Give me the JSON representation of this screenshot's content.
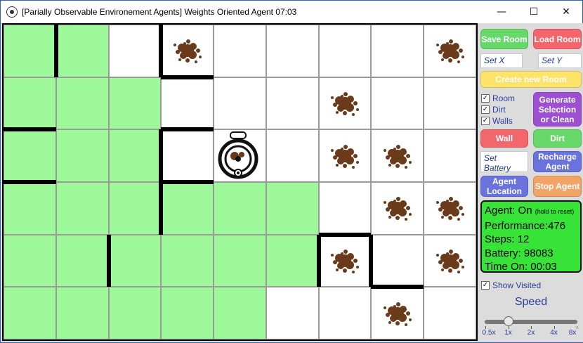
{
  "window": {
    "title": "[Parially Observable Environement Agents] Weights Oriented Agent 07:03",
    "minimize_glyph": "—",
    "maximize_glyph": "☐",
    "close_glyph": "✕"
  },
  "grid": {
    "cols": 9,
    "rows": 6,
    "visited": [
      [
        0,
        0
      ],
      [
        1,
        0
      ],
      [
        0,
        1
      ],
      [
        1,
        1
      ],
      [
        2,
        1
      ],
      [
        0,
        2
      ],
      [
        1,
        2
      ],
      [
        2,
        2
      ],
      [
        0,
        3
      ],
      [
        1,
        3
      ],
      [
        2,
        3
      ],
      [
        3,
        3
      ],
      [
        4,
        3
      ],
      [
        5,
        3
      ],
      [
        0,
        4
      ],
      [
        1,
        4
      ],
      [
        2,
        4
      ],
      [
        3,
        4
      ],
      [
        4,
        4
      ],
      [
        5,
        4
      ],
      [
        0,
        5
      ],
      [
        1,
        5
      ],
      [
        2,
        5
      ],
      [
        3,
        5
      ],
      [
        4,
        5
      ]
    ],
    "dirt": [
      [
        3,
        0
      ],
      [
        8,
        0
      ],
      [
        6,
        1
      ],
      [
        6,
        2
      ],
      [
        7,
        2
      ],
      [
        7,
        3
      ],
      [
        8,
        3
      ],
      [
        6,
        4
      ],
      [
        8,
        4
      ],
      [
        7,
        5
      ]
    ],
    "agent": [
      4,
      2
    ],
    "walls": [
      {
        "type": "v",
        "col": 1,
        "row": 0
      },
      {
        "type": "v",
        "col": 3,
        "row": 0
      },
      {
        "type": "h",
        "col": 3,
        "row": 1
      },
      {
        "type": "h",
        "col": 0,
        "row": 2
      },
      {
        "type": "h",
        "col": 3,
        "row": 2
      },
      {
        "type": "v",
        "col": 3,
        "row": 2
      },
      {
        "type": "h",
        "col": 0,
        "row": 3
      },
      {
        "type": "h",
        "col": 3,
        "row": 3
      },
      {
        "type": "v",
        "col": 3,
        "row": 3
      },
      {
        "type": "v",
        "col": 2,
        "row": 4
      },
      {
        "type": "h",
        "col": 6,
        "row": 4
      },
      {
        "type": "v",
        "col": 6,
        "row": 4
      },
      {
        "type": "v",
        "col": 7,
        "row": 4
      },
      {
        "type": "h",
        "col": 7,
        "row": 5
      }
    ]
  },
  "controls": {
    "save_room": "Save Room",
    "load_room": "Load Room",
    "set_x_placeholder": "Set X",
    "set_y_placeholder": "Set Y",
    "create_new_room": "Create new Room",
    "checkbox_room": "Room",
    "checkbox_dirt": "Dirt",
    "checkbox_walls": "Walls",
    "check_glyph": "✓",
    "generate_selection": "Generate Selection or Clean",
    "wall_button": "Wall",
    "dirt_button": "Dirt",
    "set_battery_placeholder": "Set Battery",
    "recharge_agent": "Recharge Agent",
    "agent_location": "Agent Location",
    "stop_agent": "Stop Agent",
    "show_visited": "Show Visited"
  },
  "status": {
    "agent_label": "Agent: On",
    "hold_hint": "(hold to reset)",
    "performance": "Performance:476",
    "steps": "Steps: 12",
    "battery": "Battery: 98083",
    "time_on": "Time On: 00:03"
  },
  "speed": {
    "label": "Speed",
    "ticks": [
      "0.5x",
      "1x",
      "2x",
      "4x",
      "8x"
    ],
    "selected": "1x"
  },
  "colors": {
    "visited": "#9ef99a",
    "status_bg": "#36e336",
    "dirt": "#6b3a1a"
  }
}
